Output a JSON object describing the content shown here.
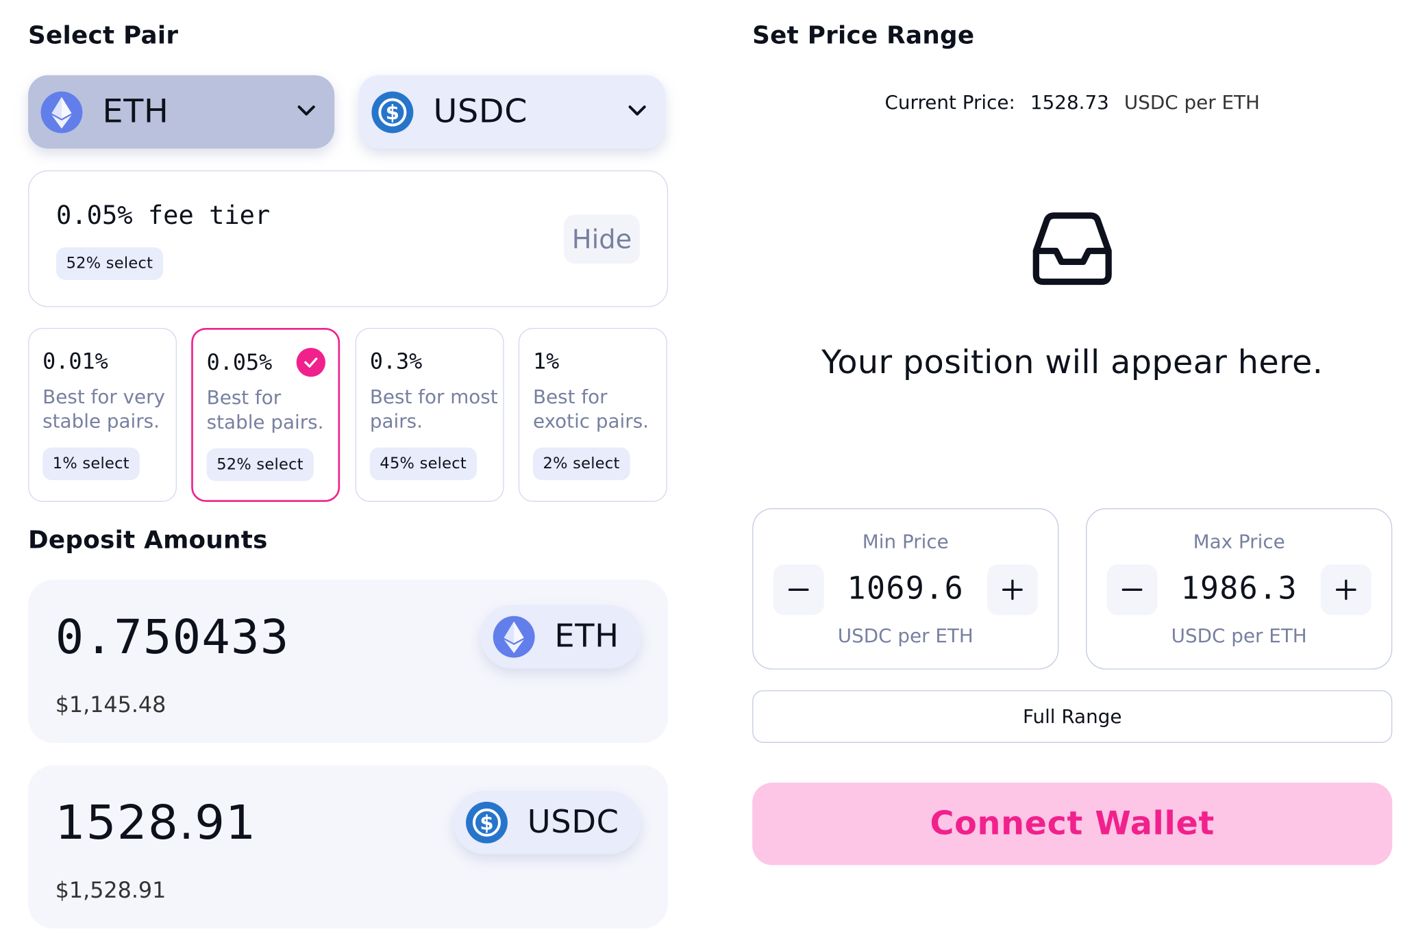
{
  "left": {
    "select_pair_title": "Select Pair",
    "token_a": {
      "symbol": "ETH",
      "icon": "eth-icon",
      "bg": "#b9c1dc"
    },
    "token_b": {
      "symbol": "USDC",
      "icon": "usdc-icon",
      "bg": "#e8ecfb"
    },
    "fee_summary": {
      "title": "0.05% fee tier",
      "badge": "52% select",
      "hide_label": "Hide"
    },
    "fee_tiers": [
      {
        "pct": "0.01%",
        "desc": "Best for very stable pairs.",
        "badge": "1% select",
        "selected": false
      },
      {
        "pct": "0.05%",
        "desc": "Best for stable pairs.",
        "badge": "52% select",
        "selected": true
      },
      {
        "pct": "0.3%",
        "desc": "Best for most pairs.",
        "badge": "45% select",
        "selected": false
      },
      {
        "pct": "1%",
        "desc": "Best for exotic pairs.",
        "badge": "2% select",
        "selected": false
      }
    ],
    "deposit_title": "Deposit Amounts",
    "deposits": [
      {
        "amount": "0.750433",
        "usd": "$1,145.48",
        "symbol": "ETH"
      },
      {
        "amount": "1528.91",
        "usd": "$1,528.91",
        "symbol": "USDC"
      }
    ]
  },
  "right": {
    "title": "Set Price Range",
    "current_price": {
      "label": "Current Price:",
      "value": "1528.73",
      "unit": "USDC per ETH"
    },
    "empty_state": {
      "icon": "inbox-icon",
      "message": "Your position will appear here."
    },
    "min_price": {
      "label": "Min Price",
      "value": "1069.6",
      "unit": "USDC per ETH"
    },
    "max_price": {
      "label": "Max Price",
      "value": "1986.3",
      "unit": "USDC per ETH"
    },
    "full_range_label": "Full Range",
    "connect_label": "Connect Wallet"
  },
  "colors": {
    "accent": "#f0218c",
    "accent_bg": "#fdc5e6",
    "muted": "#7780a0"
  }
}
